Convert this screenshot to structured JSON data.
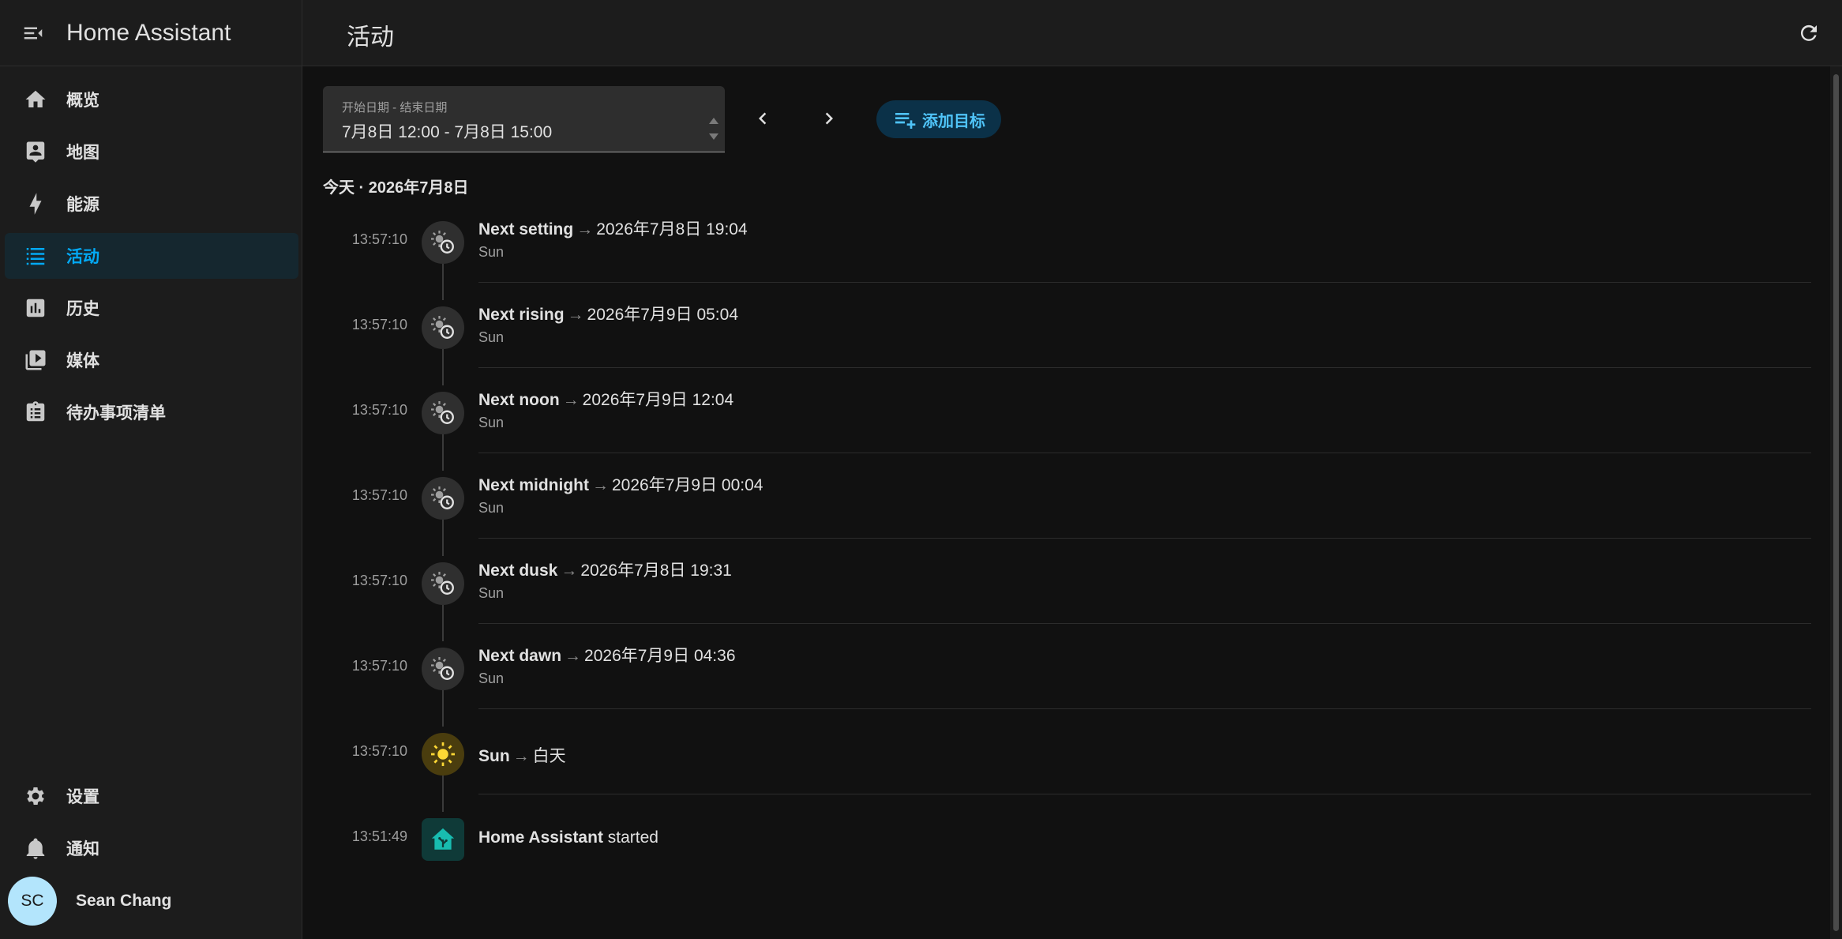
{
  "app": {
    "title": "Home Assistant"
  },
  "page": {
    "title": "活动"
  },
  "sidebar": {
    "items": [
      {
        "label": "概览",
        "icon": "home-icon"
      },
      {
        "label": "地图",
        "icon": "map-icon"
      },
      {
        "label": "能源",
        "icon": "lightning-icon"
      },
      {
        "label": "活动",
        "icon": "list-icon",
        "active": true
      },
      {
        "label": "历史",
        "icon": "chart-icon"
      },
      {
        "label": "媒体",
        "icon": "media-icon"
      },
      {
        "label": "待办事项清单",
        "icon": "clipboard-list-icon"
      }
    ],
    "bottom": [
      {
        "label": "设置",
        "icon": "gear-icon"
      },
      {
        "label": "通知",
        "icon": "bell-icon"
      }
    ],
    "user": {
      "initials": "SC",
      "name": "Sean Chang"
    }
  },
  "filter": {
    "date_label": "开始日期 - 结束日期",
    "date_value": "7月8日 12:00 - 7月8日 15:00",
    "add_target": "添加目标"
  },
  "day_header": "今天 · 2026年7月8日",
  "entries": [
    {
      "time": "13:57:10",
      "name": "Next setting",
      "value": "2026年7月8日 19:04",
      "source": "Sun",
      "icon": "sun-clock-icon"
    },
    {
      "time": "13:57:10",
      "name": "Next rising",
      "value": "2026年7月9日 05:04",
      "source": "Sun",
      "icon": "sun-clock-icon"
    },
    {
      "time": "13:57:10",
      "name": "Next noon",
      "value": "2026年7月9日 12:04",
      "source": "Sun",
      "icon": "sun-clock-icon"
    },
    {
      "time": "13:57:10",
      "name": "Next midnight",
      "value": "2026年7月9日 00:04",
      "source": "Sun",
      "icon": "sun-clock-icon"
    },
    {
      "time": "13:57:10",
      "name": "Next dusk",
      "value": "2026年7月8日 19:31",
      "source": "Sun",
      "icon": "sun-clock-icon"
    },
    {
      "time": "13:57:10",
      "name": "Next dawn",
      "value": "2026年7月9日 04:36",
      "source": "Sun",
      "icon": "sun-clock-icon"
    },
    {
      "time": "13:57:10",
      "name": "Sun",
      "value": "白天",
      "source": "",
      "icon": "sun-icon"
    },
    {
      "time": "13:51:49",
      "name": "Home Assistant",
      "value": "started",
      "source": "",
      "icon": "home-assistant-icon"
    }
  ],
  "colors": {
    "accent": "#03a9f4",
    "background": "#111111",
    "sidebar": "#1c1c1c"
  }
}
